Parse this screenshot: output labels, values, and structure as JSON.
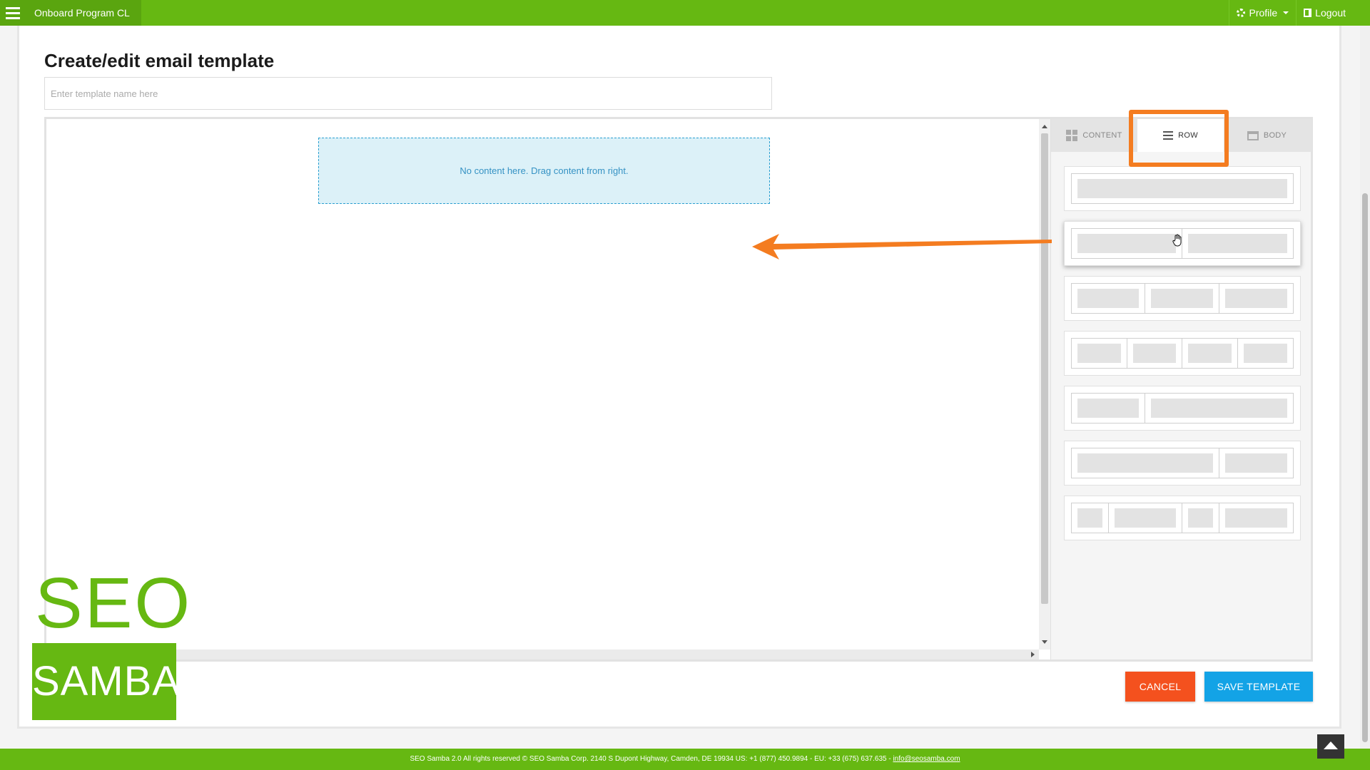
{
  "topbar": {
    "breadcrumb": "Onboard Program CL",
    "profile_label": "Profile",
    "logout_label": "Logout"
  },
  "page": {
    "title": "Create/edit email template",
    "name_placeholder": "Enter template name here"
  },
  "editor": {
    "dropzone_text": "No content here. Drag content from right.",
    "tabs": [
      {
        "label": "CONTENT",
        "icon": "grid-icon"
      },
      {
        "label": "ROW",
        "icon": "lines-icon",
        "active": true
      },
      {
        "label": "BODY",
        "icon": "window-icon"
      }
    ],
    "row_layouts": [
      {
        "columns": [
          12
        ]
      },
      {
        "columns": [
          6,
          6
        ]
      },
      {
        "columns": [
          4,
          4,
          4
        ]
      },
      {
        "columns": [
          3,
          3,
          3,
          3
        ]
      },
      {
        "columns": [
          4,
          8
        ]
      },
      {
        "columns": [
          8,
          4
        ]
      },
      {
        "columns": [
          2,
          4,
          2,
          4
        ]
      }
    ]
  },
  "logo": {
    "top": "SEO",
    "bottom": "SAMBA"
  },
  "actions": {
    "cancel_label": "CANCEL",
    "save_label": "SAVE TEMPLATE"
  },
  "footer": {
    "text": "SEO Samba 2.0  All rights reserved © SEO Samba Corp. 2140 S Dupont Highway, Camden, DE 19934 US: +1 (877) 450.9894 - EU: +33 (675) 637.635 - ",
    "email": "info@seosamba.com"
  },
  "colors": {
    "brand_green": "#66b812",
    "highlight_orange": "#f47c20",
    "cancel_red": "#f4511e",
    "save_blue": "#13a3e6"
  }
}
